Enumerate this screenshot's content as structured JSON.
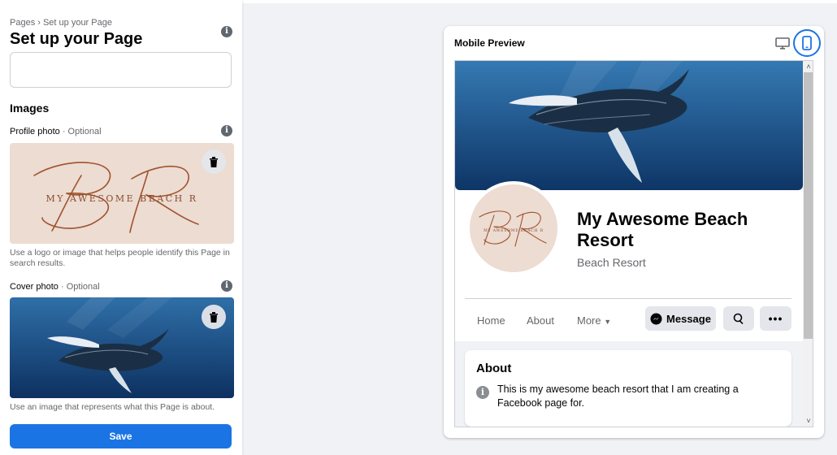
{
  "editor": {
    "breadcrumb": "Pages › Set up your Page",
    "title": "Set up your Page",
    "images_heading": "Images",
    "profile_label": "Profile photo",
    "profile_optional": " · Optional",
    "profile_help": "Use a logo or image that helps people identify this Page in search results.",
    "cover_label": "Cover photo",
    "cover_optional": " · Optional",
    "cover_help": "Use an image that represents what this Page is about.",
    "logo_text": "MY AWESOME BEACH R",
    "save_label": "Save"
  },
  "preview": {
    "title": "Mobile Preview",
    "page_name": "My Awesome Beach Resort",
    "category": "Beach Resort",
    "nav": [
      "Home",
      "About",
      "More"
    ],
    "message_label": "Message",
    "about_title": "About",
    "about_text": "This is my awesome beach resort that I am creating a Facebook page for.",
    "logo_text": "MY AWESOME BEACH R"
  },
  "colors": {
    "accent": "#1b74e4",
    "logo_brown": "#a0522d",
    "logo_bg": "#ecdcd2"
  }
}
